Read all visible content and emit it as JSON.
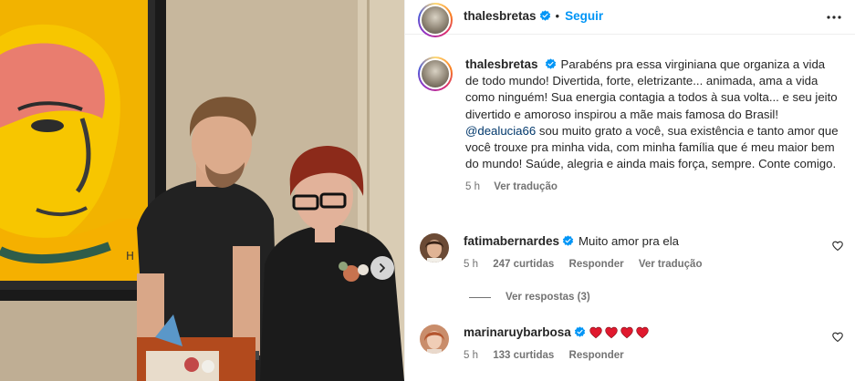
{
  "post": {
    "author": "thalesbretas",
    "follow_label": "Seguir",
    "separator": "•",
    "caption_before_mention": "Parabéns pra essa virginiana que organiza a vida de todo mundo! Divertida, forte, eletrizante... animada, ama a vida como ninguém! Sua energia contagia a todos à sua volta... e seu jeito divertido e amoroso inspirou a mãe mais famosa do Brasil! ",
    "caption_mention": "@dealucia66",
    "caption_after_mention": " sou muito grato a você, sua existência e tanto amor que você trouxe pra minha vida, com minha família que é meu maior bem do mundo! Saúde, alegria e ainda mais força, sempre. Conte comigo.",
    "time": "5 h",
    "see_translation": "Ver tradução"
  },
  "comments": [
    {
      "username": "fatimabernardes",
      "text": "Muito amor pra ela",
      "time": "5 h",
      "likes": "247 curtidas",
      "reply_label": "Responder",
      "see_translation": "Ver tradução",
      "view_replies": "Ver respostas (3)"
    },
    {
      "username": "marinaruybarbosa",
      "text": "",
      "emoji_hearts": 4,
      "time": "5 h",
      "likes": "133 curtidas",
      "reply_label": "Responder"
    }
  ],
  "icons": {
    "verified": "verified-badge-icon",
    "more": "more-options-icon",
    "like": "heart-outline-icon",
    "next": "chevron-right-icon"
  },
  "colors": {
    "link_blue": "#0095f6",
    "verified_blue": "#0095f6",
    "mention": "#00376b",
    "secondary_text": "#737373",
    "emoji_heart": "#e0192e"
  }
}
